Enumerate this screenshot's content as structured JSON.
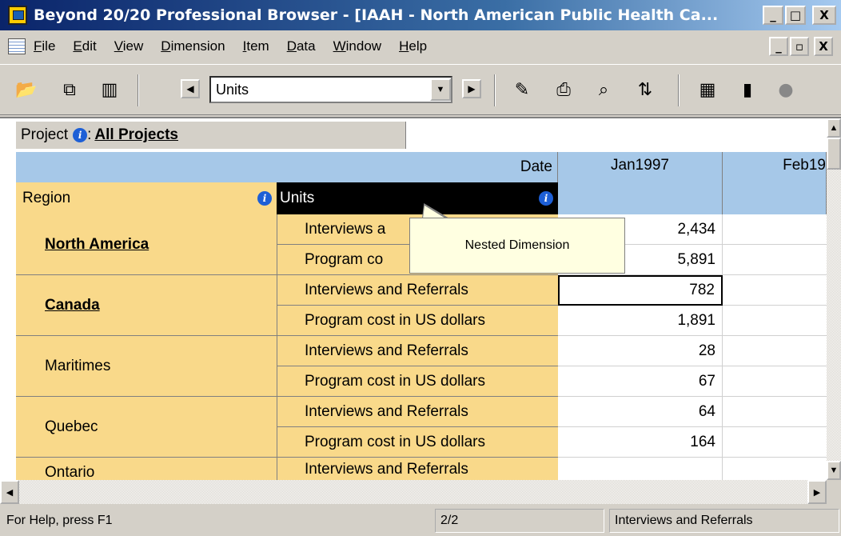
{
  "window": {
    "title": "Beyond 20/20 Professional Browser - [IAAH - North American Public Health Ca...",
    "min": "_",
    "max": "□",
    "close": "X"
  },
  "menu": {
    "items": [
      "File",
      "Edit",
      "View",
      "Dimension",
      "Item",
      "Data",
      "Window",
      "Help"
    ],
    "doc_min": "_",
    "doc_restore": "▫",
    "doc_close": "X"
  },
  "toolbar": {
    "dimension_value": "Units",
    "icons": [
      "open-icon",
      "copy-icon",
      "columns-icon",
      "prev-icon",
      "next-icon",
      "pencil-icon",
      "print-icon",
      "search-icon",
      "arrows-icon",
      "calculator-icon",
      "chart-icon",
      "globe-icon"
    ]
  },
  "table": {
    "project_label": "Project",
    "project_value": "All Projects",
    "date_label": "Date",
    "region_label": "Region",
    "units_label": "Units",
    "columns": [
      "Jan1997",
      "Feb19"
    ],
    "regions": [
      {
        "name": "North America",
        "bold": true
      },
      {
        "name": "Canada",
        "bold": true
      },
      {
        "name": "Maritimes",
        "bold": false
      },
      {
        "name": "Quebec",
        "bold": false
      },
      {
        "name": "Ontario",
        "bold": false
      }
    ],
    "units": [
      "Interviews and Referrals",
      "Program cost in US dollars",
      "Interviews and Referrals",
      "Program cost in US dollars",
      "Interviews and Referrals",
      "Program cost in US dollars",
      "Interviews and Referrals",
      "Program cost in US dollars",
      "Interviews and Referrals"
    ],
    "units_visible_first_rows": [
      "Interviews a",
      "Program co"
    ],
    "values": [
      "2,434",
      "5,891",
      "782",
      "1,891",
      "28",
      "67",
      "64",
      "164",
      ""
    ],
    "tooltip": "Nested Dimension"
  },
  "status": {
    "help": "For Help, press F1",
    "page": "2/2",
    "item": "Interviews and Referrals"
  }
}
